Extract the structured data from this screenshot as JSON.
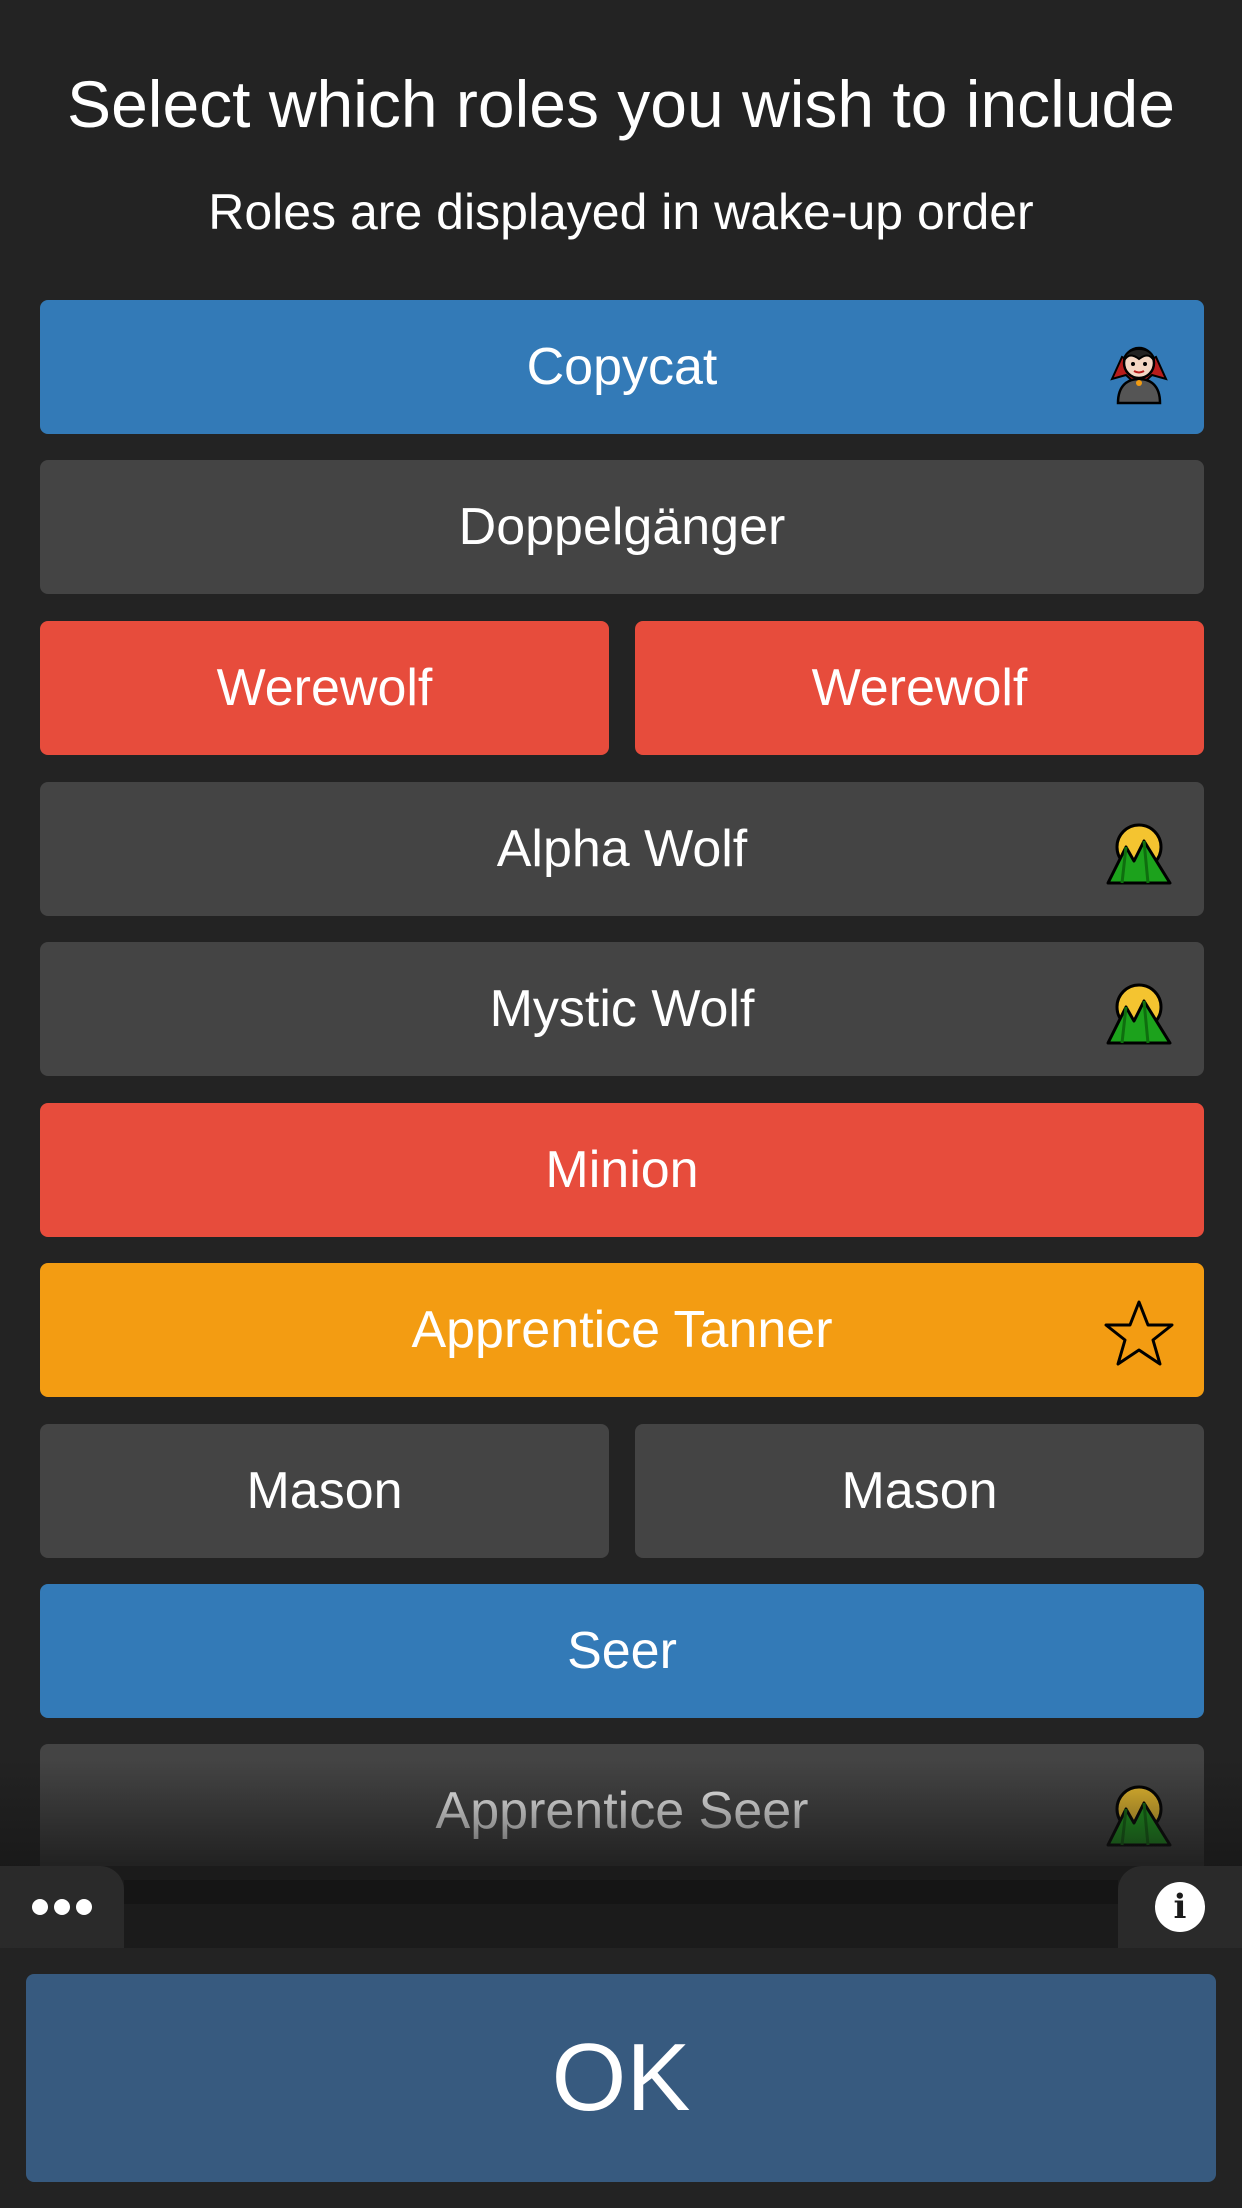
{
  "header": {
    "title": "Select which roles you wish to include",
    "subtitle": "Roles are displayed in wake-up order"
  },
  "roles": [
    {
      "label": "Copycat",
      "color": "#337ab7",
      "icon": "vampire-icon"
    },
    {
      "label": "Doppelgänger",
      "color": "#444444",
      "icon": null
    },
    {
      "label": "Werewolf",
      "color": "#e74c3c",
      "icon": null
    },
    {
      "label": "Werewolf",
      "color": "#e74c3c",
      "icon": null
    },
    {
      "label": "Alpha Wolf",
      "color": "#444444",
      "icon": "daybreak-icon"
    },
    {
      "label": "Mystic Wolf",
      "color": "#444444",
      "icon": "daybreak-icon"
    },
    {
      "label": "Minion",
      "color": "#e74c3c",
      "icon": null
    },
    {
      "label": "Apprentice Tanner",
      "color": "#f39c12",
      "icon": "star-icon"
    },
    {
      "label": "Mason",
      "color": "#444444",
      "icon": null
    },
    {
      "label": "Mason",
      "color": "#444444",
      "icon": null
    },
    {
      "label": "Seer",
      "color": "#337ab7",
      "icon": null
    },
    {
      "label": "Apprentice Seer",
      "color": "#444444",
      "icon": "daybreak-icon"
    }
  ],
  "toolbar": {
    "left_icon": "more-dots-icon",
    "right_icon": "info-icon",
    "info_glyph": "i"
  },
  "ok_button": {
    "label": "OK",
    "color": "#375a7f"
  },
  "colors": {
    "background": "#232323",
    "blue": "#337ab7",
    "gray": "#444444",
    "red": "#e74c3c",
    "orange": "#f39c12"
  }
}
